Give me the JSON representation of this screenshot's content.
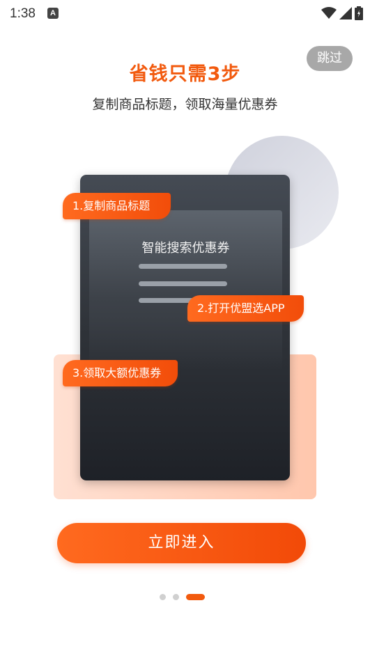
{
  "status_bar": {
    "time": "1:38",
    "notification_glyph": "A",
    "icons": [
      "wifi-icon",
      "signal-icon",
      "battery-icon"
    ]
  },
  "skip_label": "跳过",
  "headline": "省钱只需3步",
  "subline": "复制商品标题，领取海量优惠券",
  "illustration": {
    "phone_title": "智能搜索优惠券",
    "steps": [
      {
        "label": "1.复制商品标题"
      },
      {
        "label": "2.打开优盟选APP"
      },
      {
        "label": "3.领取大额优惠券"
      }
    ]
  },
  "enter_button": "立即进入",
  "pager": {
    "count": 3,
    "active_index": 2
  },
  "colors": {
    "accent": "#f25a0e",
    "skip_bg": "#a8a8a8",
    "phone_dark": "#2f3339",
    "peach": "#ffd2bd"
  }
}
